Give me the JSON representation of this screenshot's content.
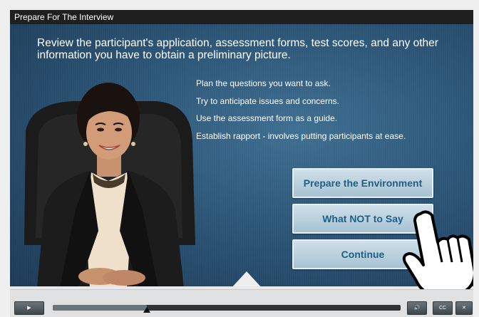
{
  "window": {
    "title": "Prepare For The Interview"
  },
  "slide": {
    "heading": "Review the participant's application, assessment forms, test scores, and any other information you have to obtain a preliminary picture.",
    "bullets": [
      "Plan the questions you want to ask.",
      "Try to anticipate issues and concerns.",
      "Use the assessment form as a guide.",
      "Establish rapport -  involves putting participants at ease."
    ],
    "buttons": [
      {
        "label": "Prepare the Environment"
      },
      {
        "label": "What NOT to Say"
      },
      {
        "label": "Continue"
      }
    ]
  },
  "player": {
    "progress": 0.27,
    "play_icon": "▶",
    "volume_icon": "🔊",
    "cc_label": "CC",
    "close_icon": "✕"
  },
  "colors": {
    "slide_bg": "#2c5576",
    "button_text": "#1d5f86",
    "button_bg": "#b9d0de",
    "titlebar_bg": "#1f1f1f"
  }
}
